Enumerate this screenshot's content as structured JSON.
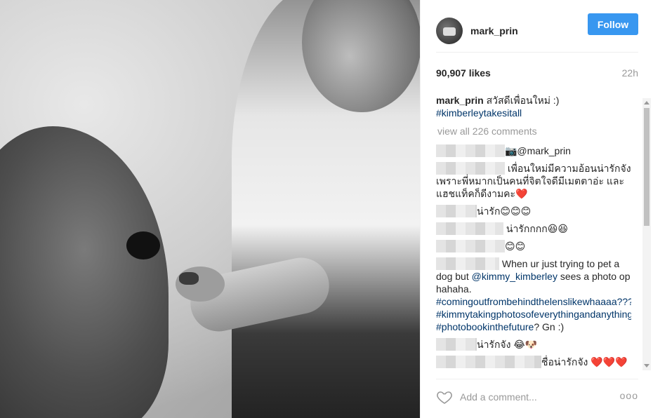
{
  "post": {
    "username": "mark_prin",
    "follow_label": "Follow",
    "likes": "90,907 likes",
    "age": "22h"
  },
  "caption": {
    "username": "mark_prin",
    "text": " สวัสดีเพื่อนใหม่ :)",
    "hashtag": "#kimberleytakesitall"
  },
  "view_all": "view all 226 comments",
  "comments": [
    {
      "text": "📷@mark_prin"
    },
    {
      "text": " เพื่อนใหม่มีความอ้อนน่ารักจังเพราะพี่หมากเป็นคนที่จิตใจดีมีเมตตาอ่ะ และแฮชแท็คก็ดีงามคะ❤️"
    },
    {
      "text": "น่ารัก😊😊😊"
    },
    {
      "text": " น่ารักกกก😆😆"
    },
    {
      "text": "😊😊"
    },
    {
      "text_a": " When ur just trying to pet a dog but ",
      "mention": "@kimmy_kimberley",
      "text_b": " sees a photo op hahaha. ",
      "tag1": "#comingoutfrombehindthelenslikewhaaaa???",
      "tag2": "#kimmytakingphotosofeverythingandanything",
      "tag3": "#photobookinthefuture",
      "text_c": "? Gn :)"
    },
    {
      "text": "น่ารักจัง 😂🐶"
    },
    {
      "text": "ชื่อน่ารักจัง ❤️❤️❤️"
    }
  ],
  "footer": {
    "add_comment": "Add a comment...",
    "more": "ooo"
  },
  "icons": {
    "heart": "heart-icon",
    "more": "more-options-icon"
  },
  "colors": {
    "follow_blue": "#3897f0",
    "hashtag": "#003569",
    "muted": "#999999"
  }
}
